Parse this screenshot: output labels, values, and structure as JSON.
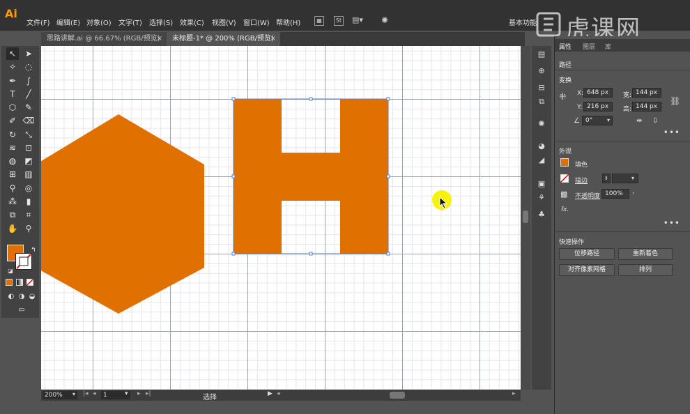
{
  "app": {
    "logo": "Ai",
    "menu": [
      "文件(F)",
      "编辑(E)",
      "对象(O)",
      "文字(T)",
      "选择(S)",
      "效果(C)",
      "视图(V)",
      "窗口(W)",
      "帮助(H)"
    ],
    "workspace": "基本功能",
    "watermark": "虎课网"
  },
  "tabs": [
    {
      "label": "思路讲解.ai @ 66.67% (RGB/预览)",
      "close": "×"
    },
    {
      "label": "未标题-1* @ 200% (RGB/预览)",
      "close": "×"
    }
  ],
  "canvas": {
    "fill_color": "#e07100",
    "highlight_color": "#f6f20a"
  },
  "status": {
    "zoom": "200%",
    "page": "1",
    "tool_status": "选择"
  },
  "panel": {
    "tabs": [
      "属性",
      "图层",
      "库"
    ],
    "section_path": "路径",
    "section_transform": "变换",
    "x_label": "X:",
    "x_value": "648 px",
    "y_label": "Y:",
    "y_value": "216 px",
    "w_label": "宽:",
    "w_value": "144 px",
    "h_label": "高:",
    "h_value": "144 px",
    "angle_value": "0°",
    "section_appearance": "外观",
    "fill_label": "填色",
    "stroke_label": "描边",
    "opacity_label": "不透明度",
    "opacity_value": "100%",
    "fx_label": "fx.",
    "section_quick": "快速操作",
    "btn_offset_path": "位移路径",
    "btn_recolor": "重新着色",
    "btn_align_pixel": "对齐像素网格",
    "btn_arrange": "排列",
    "more": "•••"
  }
}
